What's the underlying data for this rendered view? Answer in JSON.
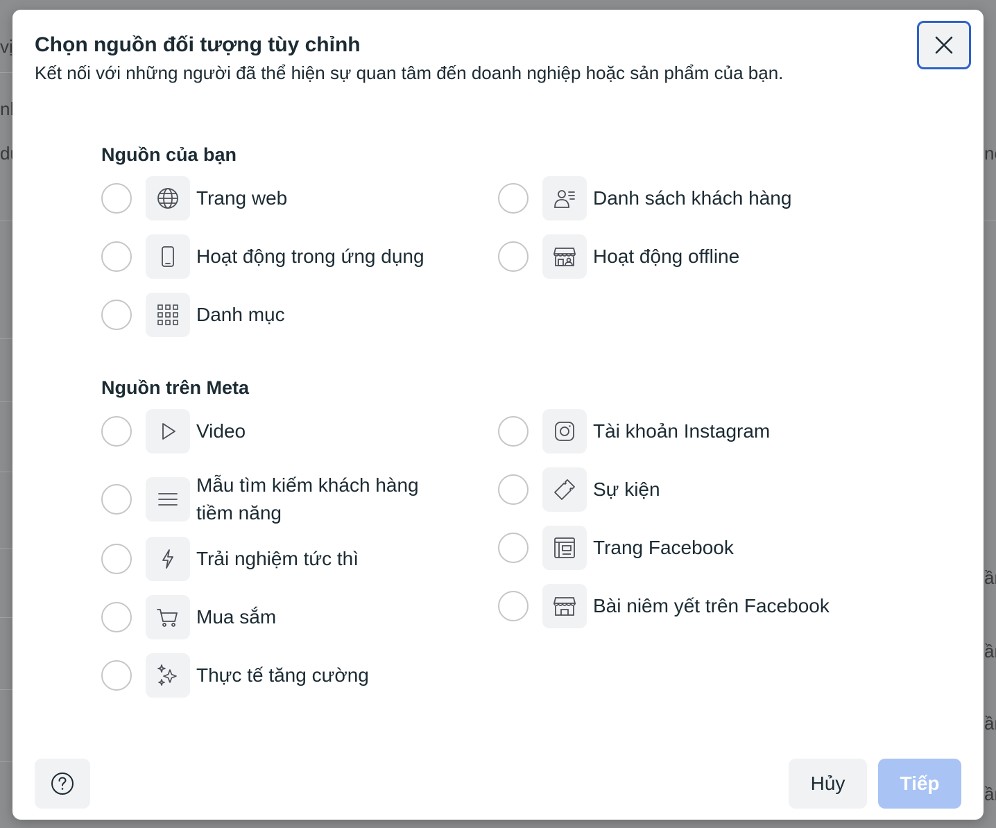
{
  "background": {
    "left_fragments": [
      "vị",
      "nh",
      "du"
    ],
    "right_fragments": [
      "nc",
      "ần",
      "ần",
      "ần",
      "ần"
    ]
  },
  "dialog": {
    "title": "Chọn nguồn đối tượng tùy chỉnh",
    "subtitle": "Kết nối với những người đã thể hiện sự quan tâm đến doanh nghiệp hoặc sản phẩm của bạn.",
    "close_icon": "close-icon"
  },
  "sections": {
    "your_sources": {
      "heading": "Nguồn của bạn",
      "options": [
        {
          "label": "Trang web",
          "icon": "globe-icon",
          "selected": false
        },
        {
          "label": "Danh sách khách hàng",
          "icon": "customer-list-icon",
          "selected": false
        },
        {
          "label": "Hoạt động trong ứng dụng",
          "icon": "mobile-phone-icon",
          "selected": false
        },
        {
          "label": "Hoạt động offline",
          "icon": "store-people-icon",
          "selected": false
        },
        {
          "label": "Danh mục",
          "icon": "grid-icon",
          "selected": false
        }
      ]
    },
    "meta_sources": {
      "heading": "Nguồn trên Meta",
      "options": [
        {
          "label": "Video",
          "icon": "play-icon",
          "selected": false
        },
        {
          "label": "Tài khoản Instagram",
          "icon": "instagram-icon",
          "selected": false
        },
        {
          "label": "Mẫu tìm kiếm khách hàng",
          "label_line2": "tiềm năng",
          "icon": "lines-icon",
          "selected": false
        },
        {
          "label": "Sự kiện",
          "icon": "ticket-icon",
          "selected": false
        },
        {
          "label": "Trải nghiệm tức thì",
          "icon": "lightning-icon",
          "selected": false
        },
        {
          "label": "Trang Facebook",
          "icon": "facebook-page-icon",
          "selected": false
        },
        {
          "label": "Mua sắm",
          "icon": "shopping-cart-icon",
          "selected": false
        },
        {
          "label": "Bài niêm yết trên Facebook",
          "icon": "storefront-icon",
          "selected": false
        },
        {
          "label": "Thực tế tăng cường",
          "icon": "sparkles-icon",
          "selected": false
        }
      ]
    }
  },
  "footer": {
    "help_icon": "help-icon",
    "cancel_label": "Hủy",
    "next_label": "Tiếp"
  },
  "colors": {
    "accent_border": "#2d62c8",
    "disabled_primary": "#a8c3f4",
    "icon_box": "#f1f2f4"
  }
}
